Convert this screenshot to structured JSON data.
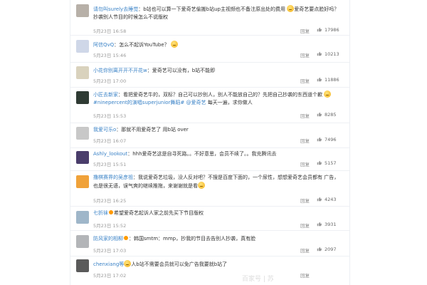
{
  "comments": [
    {
      "user": "请勿叫surely去睡觉",
      "body": "：b站也可以算一下爱奇艺偷搬b站up主视频也不备注原出处的费用",
      "body_2": "爱奇艺要点脸好吗？抄袭别人节目的时候怎么不说版权",
      "time": "5月23日 16:58",
      "reply": "回复",
      "likes": "17986",
      "avatar_color": "#b7b0a8"
    },
    {
      "user": "阿信QvQ",
      "body": "：怎么不起诉YouTube？",
      "time": "5月23日 15:46",
      "reply": "回复",
      "likes": "10213",
      "avatar_color": "#cfd7e8"
    },
    {
      "user": "小花你别离开开不开花w",
      "body": "：爱奇艺可以没有，b站不能即",
      "time": "5月23日 17:00",
      "reply": "回复",
      "likes": "11886",
      "avatar_color": "#d9d2bd"
    },
    {
      "user": "小匠去新家",
      "body": "：看把爱奇艺牛的，双标？自己可以抄别人，别人不能放自己的？先把自己抄袭的东西道个歉",
      "tag": "#ninepercent的演唱superjunior舞蹈# @爱奇艺",
      "body_2": "每天一遍，求你做人",
      "time": "5月23日 15:53",
      "reply": "回复",
      "likes": "8285",
      "avatar_color": "#2f3b34"
    },
    {
      "user": "我爱可乐o",
      "body": "：那就不用爱奇艺了 用b站 over",
      "time": "5月23日 16:07",
      "reply": "回复",
      "likes": "7496",
      "avatar_color": "#c8c8c8"
    },
    {
      "user": "Ashly_lookout",
      "body": "：hhh爱奇艺这是自寻死路。。不好意思，会员不续了。。我充腾讯去",
      "time": "5月23日 15:51",
      "reply": "回复",
      "likes": "5157",
      "avatar_color": "#4a3d6b"
    },
    {
      "user": "撸棋赛界的吴彦祖",
      "body": "：我说爱奇艺垃圾，没人反对吧？不搜是百度下面的，一个尿性，想想爱奇艺会员都有",
      "body_2": "广告，也是很无语，误气爽的继续推拖，来谢谢就是看",
      "time": "5月23日 16:25",
      "reply": "回复",
      "likes": "4243",
      "avatar_color": "#f0a23a"
    },
    {
      "user": "七折袜",
      "body": "希望爱奇艺起诉人家之前先买下节目版权",
      "time": "5月23日 15:52",
      "reply": "回复",
      "likes": "3931",
      "avatar_color": "#9fb6c9"
    },
    {
      "user": "防风家的相柳",
      "body": "：韩国smtm：mmp，抄我的节目去告别人抄袭，真有脸",
      "time": "5月23日 17:03",
      "reply": "回复",
      "likes": "2097",
      "avatar_color": "#b3b5b8"
    },
    {
      "user": "chenxiang等",
      "body": "人b站不需要会员就可以免广告我要就b站了",
      "time": "5月23日 17:02",
      "reply": "回复",
      "likes": "",
      "avatar_color": "#5a5a5a"
    }
  ],
  "watermark": "百家号 | 苏"
}
